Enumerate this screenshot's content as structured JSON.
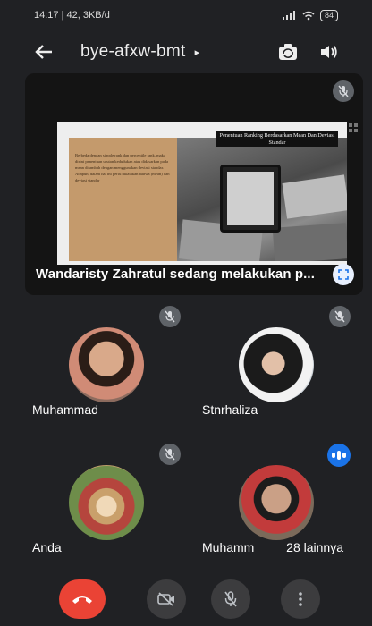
{
  "status_bar": {
    "time_info": "14:17 | 42, 3KB/d",
    "battery": "84"
  },
  "app_bar": {
    "meeting_code": "bye-afxw-bmt",
    "code_caret": "▸"
  },
  "presentation": {
    "slide_title": "Penentuan Ranking Berdasarkan Mean Dan Deviasi Standar",
    "slide_body": "Berbeda dengan simple rank dan percentile rank, maka disini penentuan urutan kedudukan atau didasarkan pada mean ditambah dengan menggunakan deviasi standar. Adapun, dalam hal ini perlu dikatakan bahwa (mean) dan deviasi standar",
    "presenter_label": "Wandaristy Zahratul sedang melakukan p..."
  },
  "participants": [
    {
      "name": "Muhammad",
      "muted": true
    },
    {
      "name": "Stnrhaliza",
      "muted": true
    },
    {
      "name": "Anda",
      "muted": true
    },
    {
      "name": "Muhamm",
      "speaking": true,
      "more": "28 lainnya"
    }
  ],
  "controls": [
    "end-call",
    "camera-off",
    "mic-off",
    "more-options"
  ],
  "colors": {
    "background": "#202124",
    "end_call": "#ea4335",
    "speaking": "#1a73e8",
    "chip": "#5f6368"
  }
}
